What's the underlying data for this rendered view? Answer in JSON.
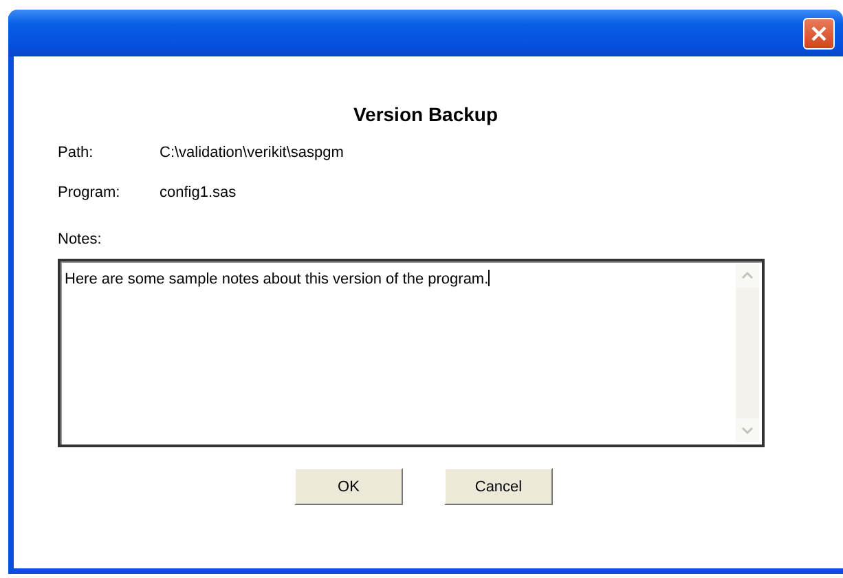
{
  "window": {
    "title": "Version Backup"
  },
  "fields": [
    {
      "label": "Path:",
      "value": "C:\\validation\\verikit\\saspgm"
    },
    {
      "label": "Program:",
      "value": "config1.sas"
    }
  ],
  "notes": {
    "label": "Notes:",
    "value": "Here are some sample notes about this version of the program."
  },
  "buttons": [
    "OK",
    "Cancel"
  ]
}
